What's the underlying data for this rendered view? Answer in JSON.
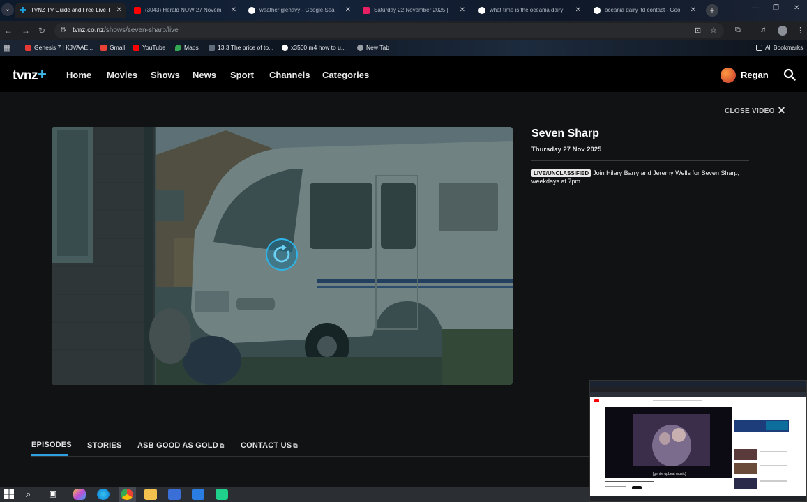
{
  "browser": {
    "tabs": [
      {
        "label": "TVNZ TV Guide and Free Live T",
        "active": true,
        "favicon_color": "#1ba3e0"
      },
      {
        "label": "(3043) Herald NOW 27 Novem",
        "active": false,
        "favicon_color": "#ff0000"
      },
      {
        "label": "weather glenavy - Google Sea",
        "active": false,
        "favicon_color": "#ffffff"
      },
      {
        "label": "Saturday 22 November 2025 |",
        "active": false,
        "favicon_color": "#e91e63"
      },
      {
        "label": "what time is the oceania dairy",
        "active": false,
        "favicon_color": "#ffffff"
      },
      {
        "label": "oceania dairy ltd contact - Goo",
        "active": false,
        "favicon_color": "#ffffff"
      }
    ],
    "url_host": "tvnz.co.nz",
    "url_path": "/shows/seven-sharp/live",
    "bookmarks": [
      {
        "label": "Genesis 7 | KJVAAE...",
        "color": "#e53935"
      },
      {
        "label": "Gmail",
        "color": "#ea4335"
      },
      {
        "label": "YouTube",
        "color": "#ff0000"
      },
      {
        "label": "Maps",
        "color": "#34a853"
      },
      {
        "label": "13.3 The price of to...",
        "color": "#5f6d7a"
      },
      {
        "label": "x3500 m4 how to u...",
        "color": "#ffffff"
      },
      {
        "label": "New Tab",
        "color": "#9aa0a6"
      }
    ],
    "all_bookmarks": "All Bookmarks"
  },
  "site": {
    "logo": "tvnz",
    "logo_plus": "+",
    "nav": [
      "Home",
      "Movies",
      "Shows",
      "News",
      "Sport",
      "Channels",
      "Categories"
    ],
    "user": "Regan",
    "close_video": "CLOSE VIDEO",
    "show": {
      "title": "Seven Sharp",
      "date": "Thursday 27 Nov 2025",
      "badge": "LIVE/UNCLASSIFIED",
      "description": "Join Hilary Barry and Jeremy Wells for Seven Sharp, weekdays at 7pm."
    },
    "tabs": [
      {
        "label": "EPISODES",
        "external": false,
        "active": true
      },
      {
        "label": "STORIES",
        "external": false,
        "active": false
      },
      {
        "label": "ASB GOOD AS GOLD",
        "external": true,
        "active": false
      },
      {
        "label": "CONTACT US",
        "external": true,
        "active": false
      }
    ]
  },
  "pip": {
    "caption": "[gentle upbeat music]"
  },
  "colors": {
    "accent": "#2f9fe0",
    "background": "#111214"
  }
}
